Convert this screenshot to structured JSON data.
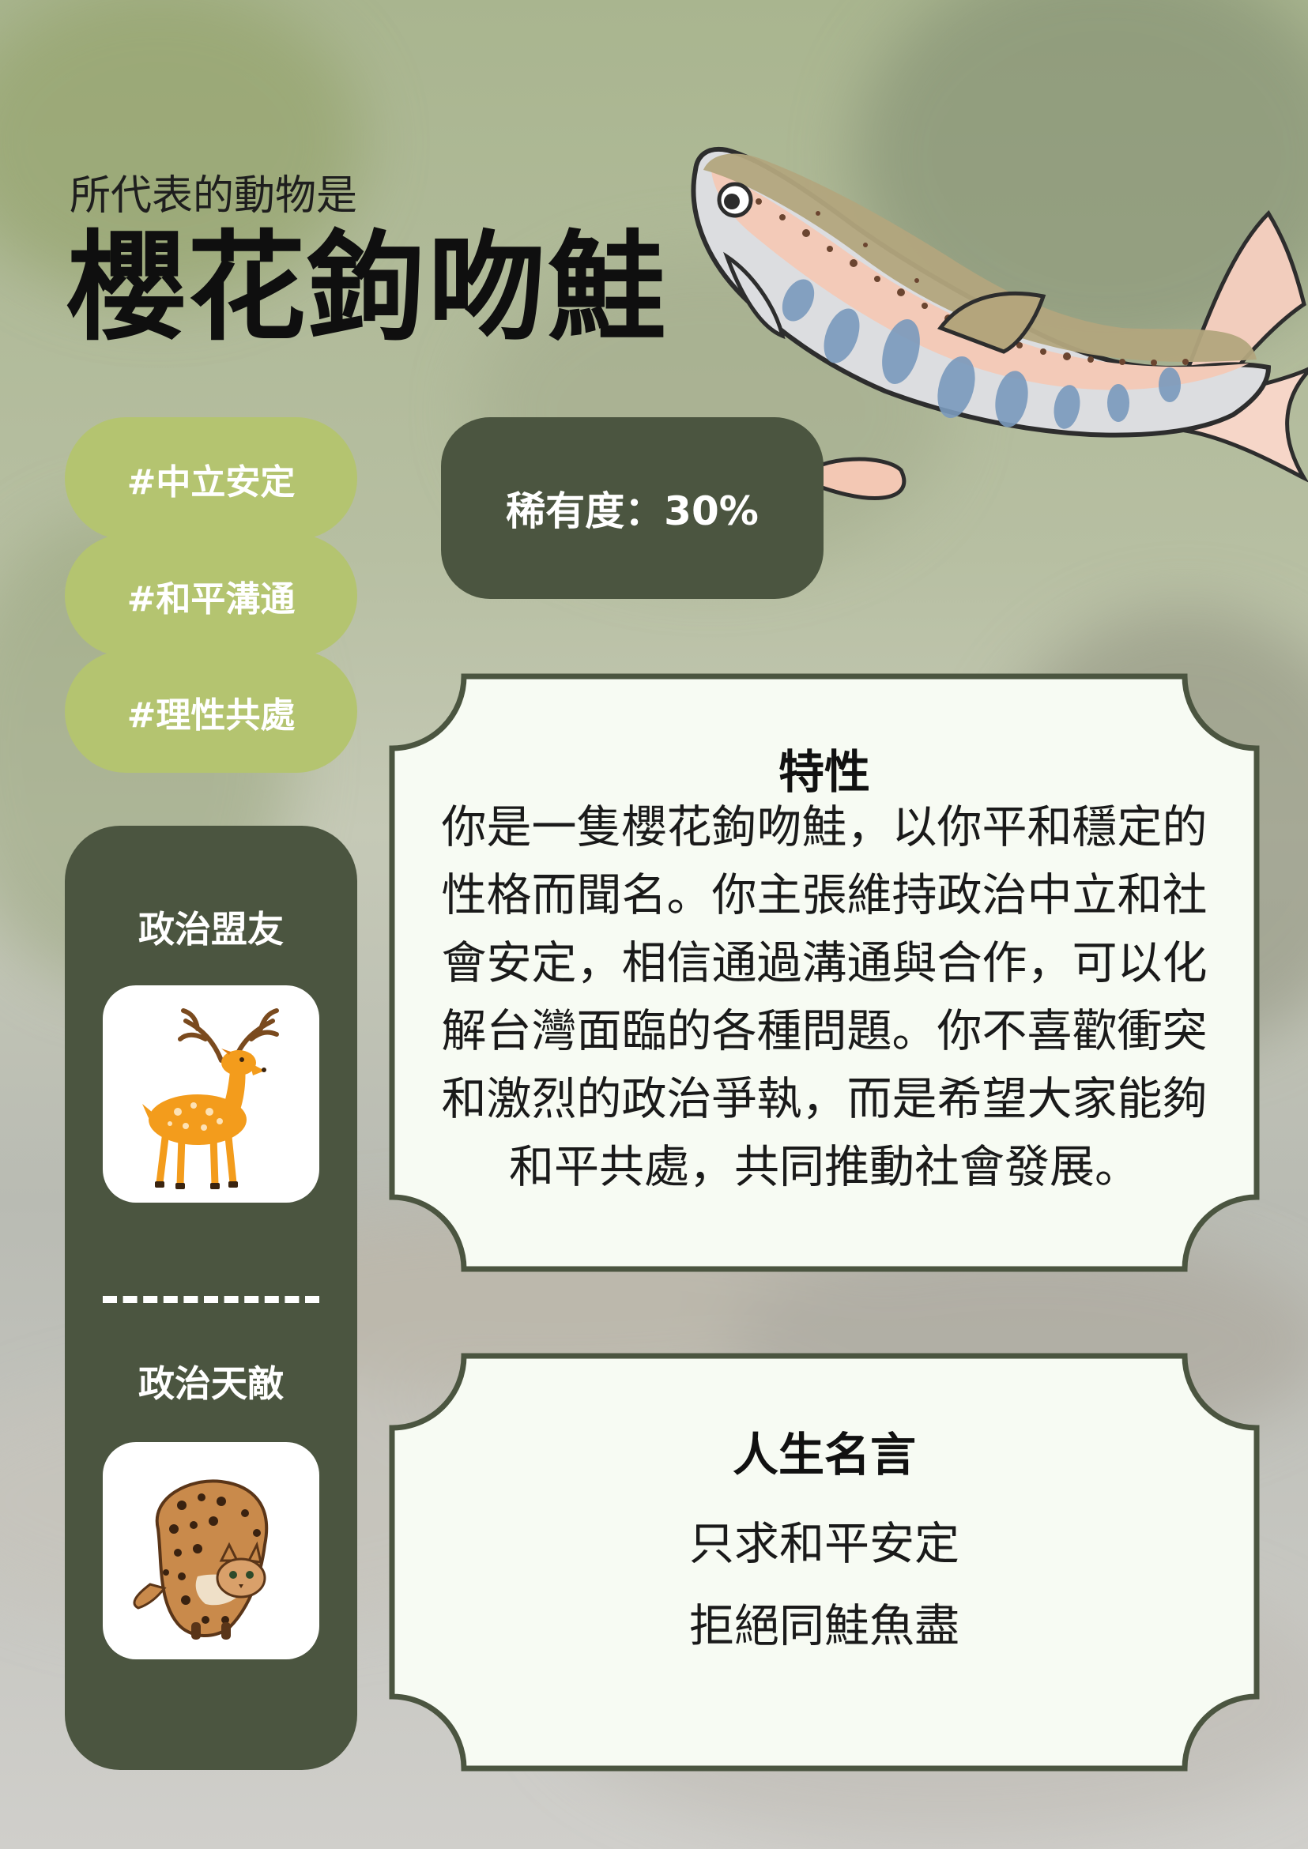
{
  "header": {
    "subtitle": "所代表的動物是",
    "title": "櫻花鉤吻鮭"
  },
  "tags": [
    "#中立安定",
    "#和平溝通",
    "#理性共處"
  ],
  "rarity": "稀有度：30%",
  "sidebar": {
    "ally_label": "政治盟友",
    "ally_icon": "deer-icon",
    "enemy_label": "政治天敵",
    "enemy_icon": "leopard-cat-icon"
  },
  "traits": {
    "heading": "特性",
    "lines": [
      "你是一隻櫻花鉤吻鮭，以你平和穩定的",
      "性格而聞名。你主張維持政治中立和社",
      "會安定，相信通過溝通與合作，可以化",
      "解台灣面臨的各種問題。你不喜歡衝突",
      "和激烈的政治爭執，而是希望大家能夠",
      "和平共處，共同推動社會發展。"
    ]
  },
  "motto": {
    "heading": "人生名言",
    "lines": [
      "只求和平安定",
      "拒絕同鮭魚盡"
    ]
  },
  "colors": {
    "tag_bg": "#b4c470",
    "dark_green": "#4b5540",
    "panel_bg": "#f7fbf3"
  },
  "illustration": "salmon-icon"
}
